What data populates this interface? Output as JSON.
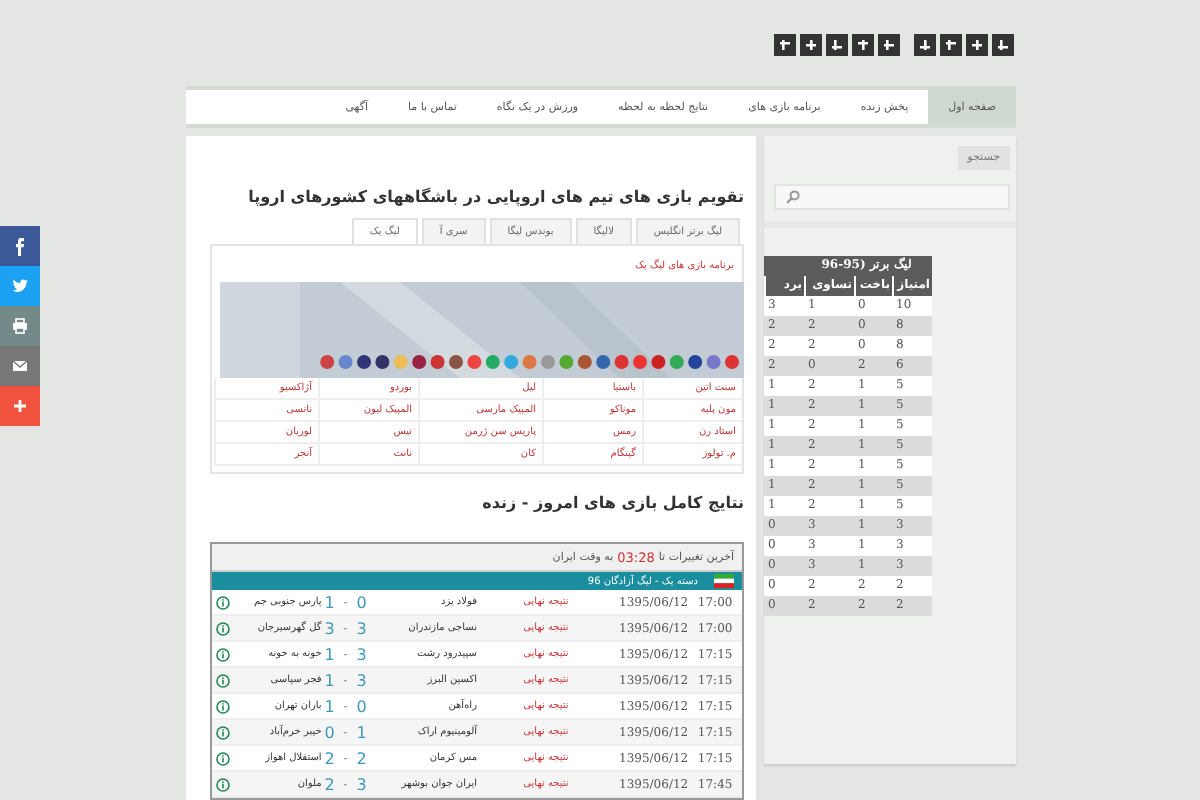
{
  "social_bar": [
    {
      "kind": "facebook"
    },
    {
      "kind": "twitter"
    },
    {
      "kind": "print"
    },
    {
      "kind": "email"
    },
    {
      "kind": "more"
    }
  ],
  "nav": [
    {
      "label": "صفحه اول",
      "selected": true
    },
    {
      "label": "پخش زنده",
      "selected": false
    },
    {
      "label": "برنامه بازی های",
      "selected": false
    },
    {
      "label": "نتایج لحظه به لحظه",
      "selected": false
    },
    {
      "label": "ورزش در یک نگاه",
      "selected": false
    },
    {
      "label": "تماس با ما",
      "selected": false
    },
    {
      "label": "آگهی",
      "selected": false
    }
  ],
  "search": {
    "button": "جستجو"
  },
  "league_table": {
    "title": "لیگ برتر (95-96",
    "columns": [
      "امتیاز",
      "باخت",
      "تساوی",
      "برد"
    ],
    "rows": [
      [
        "10",
        "0",
        "1",
        "3"
      ],
      [
        "8",
        "0",
        "2",
        "2"
      ],
      [
        "8",
        "0",
        "2",
        "2"
      ],
      [
        "6",
        "2",
        "0",
        "2"
      ],
      [
        "5",
        "1",
        "2",
        "1"
      ],
      [
        "5",
        "1",
        "2",
        "1"
      ],
      [
        "5",
        "1",
        "2",
        "1"
      ],
      [
        "5",
        "1",
        "2",
        "1"
      ],
      [
        "5",
        "1",
        "2",
        "1"
      ],
      [
        "5",
        "1",
        "2",
        "1"
      ],
      [
        "5",
        "1",
        "2",
        "1"
      ],
      [
        "3",
        "1",
        "3",
        "0"
      ],
      [
        "3",
        "1",
        "3",
        "0"
      ],
      [
        "3",
        "1",
        "3",
        "0"
      ],
      [
        "2",
        "2",
        "2",
        "0"
      ],
      [
        "2",
        "2",
        "2",
        "0"
      ]
    ]
  },
  "content_title": "تقویم بازی های تیم های اروپایی در باشگاههای کشورهای اروپا",
  "tabs": [
    {
      "label": "لیگ برتر انگلیس",
      "selected": false
    },
    {
      "label": "لالیگا",
      "selected": false
    },
    {
      "label": "بوندس لیگا",
      "selected": false
    },
    {
      "label": "سری آ",
      "selected": false
    },
    {
      "label": "لیگ یک",
      "selected": true
    }
  ],
  "schedule_link": "برنامه بازی های لیگ یک",
  "teams": [
    [
      "سنت اتین",
      "باستیا",
      "لیل",
      "بوردو",
      "آژاکسیو"
    ],
    [
      "مون پلیه",
      "موناکو",
      "المپیک مارسی",
      "المپیک لیون",
      "نانسی"
    ],
    [
      "استاد رن",
      "رمس",
      "پاریس سن ژرمن",
      "نیس",
      "لوریان"
    ],
    [
      "م. تولوز",
      "گینگام",
      "کان",
      "نانت",
      "آنجر"
    ]
  ],
  "results_title": "نتایج کامل بازی های امروز - زنده",
  "results": {
    "updated_prefix": "آخرین تغییرات تا",
    "updated_time": "03:28",
    "updated_suffix": "به وقت ایران",
    "league": "دسته یک - لیگ آزادگان 96",
    "matches": [
      {
        "time": "17:00",
        "date": "1395/06/12",
        "status": "نتیجه نهایی",
        "home": "فولاد یزد",
        "home_score": "0",
        "separator": "-",
        "away_score": "1",
        "away": "پارس جنوبی جم"
      },
      {
        "time": "17:00",
        "date": "1395/06/12",
        "status": "نتیجه نهایی",
        "home": "نساجی مازندران",
        "home_score": "3",
        "separator": "-",
        "away_score": "3",
        "away": "گل گهرسیرجان"
      },
      {
        "time": "17:15",
        "date": "1395/06/12",
        "status": "نتیجه نهایی",
        "home": "سپیدرود رشت",
        "home_score": "3",
        "separator": "-",
        "away_score": "1",
        "away": "خونه به خونه"
      },
      {
        "time": "17:15",
        "date": "1395/06/12",
        "status": "نتیجه نهایی",
        "home": "اکسین البرز",
        "home_score": "3",
        "separator": "-",
        "away_score": "1",
        "away": "فجر سپاسی"
      },
      {
        "time": "17:15",
        "date": "1395/06/12",
        "status": "نتیجه نهایی",
        "home": "راه‌آهن",
        "home_score": "0",
        "separator": "-",
        "away_score": "1",
        "away": "باران تهران"
      },
      {
        "time": "17:15",
        "date": "1395/06/12",
        "status": "نتیجه نهایی",
        "home": "آلومینیوم اراک",
        "home_score": "1",
        "separator": "-",
        "away_score": "0",
        "away": "خیبر خرم‌آباد"
      },
      {
        "time": "17:15",
        "date": "1395/06/12",
        "status": "نتیجه نهایی",
        "home": "مس کرمان",
        "home_score": "2",
        "separator": "-",
        "away_score": "2",
        "away": "استقلال اهواز"
      },
      {
        "time": "17:45",
        "date": "1395/06/12",
        "status": "نتیجه نهایی",
        "home": "ایران جوان بوشهر",
        "home_score": "3",
        "separator": "-",
        "away_score": "2",
        "away": "ملوان"
      }
    ]
  }
}
